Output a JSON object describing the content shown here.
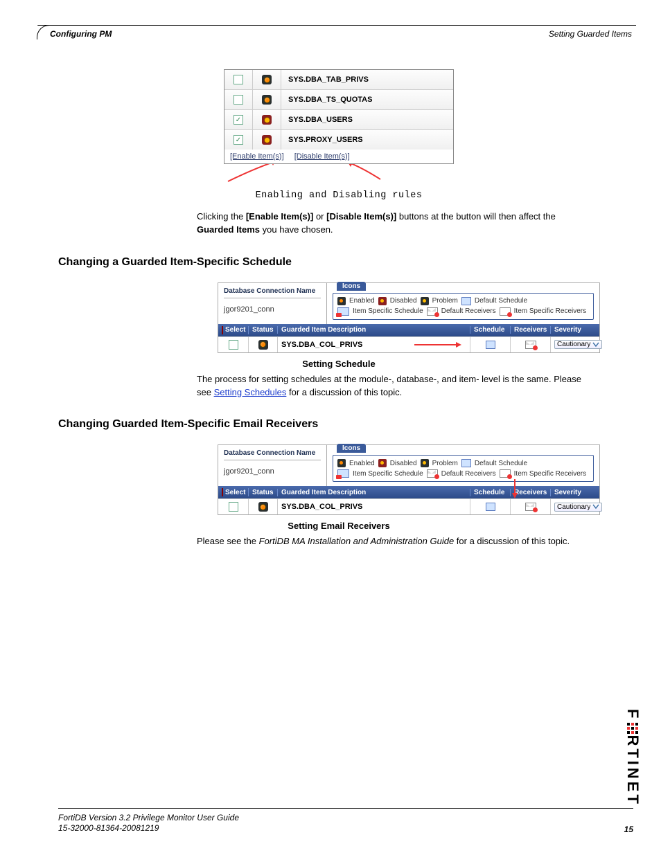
{
  "header": {
    "left": "Configuring PM",
    "right": "Setting Guarded Items"
  },
  "fig1": {
    "rows": [
      {
        "checked": false,
        "enabled": true,
        "desc": "SYS.DBA_TAB_PRIVS"
      },
      {
        "checked": false,
        "enabled": true,
        "desc": "SYS.DBA_TS_QUOTAS"
      },
      {
        "checked": true,
        "enabled": false,
        "desc": "SYS.DBA_USERS"
      },
      {
        "checked": true,
        "enabled": false,
        "desc": "SYS.PROXY_USERS"
      }
    ],
    "link_enable": "[Enable Item(s)]",
    "link_disable": "[Disable Item(s)]",
    "caption": "Enabling and Disabling rules"
  },
  "para1a": "Clicking the ",
  "para1b": "[Enable Item(s)]",
  "para1c": " or ",
  "para1d": "[Disable Item(s)]",
  "para1e": " buttons at the button will then affect the ",
  "para1f": "Guarded Items",
  "para1g": " you have chosen.",
  "section2": "Changing a Guarded Item-Specific Schedule",
  "panel": {
    "db_label": "Database Connection Name",
    "db_value": "jgor9201_conn",
    "icons_title": "Icons",
    "legend": {
      "enabled": "Enabled",
      "disabled": "Disabled",
      "problem": "Problem",
      "default_schedule": "Default Schedule",
      "item_specific_schedule": "Item Specific Schedule",
      "default_receivers": "Default Receivers",
      "item_specific_receivers": "Item Specific Receivers"
    },
    "grid_head": {
      "select": "Select",
      "status": "Status",
      "desc": "Guarded Item Description",
      "schedule": "Schedule",
      "receivers": "Receivers",
      "severity": "Severity"
    },
    "grid_row": {
      "desc": "SYS.DBA_COL_PRIVS",
      "severity": "Cautionary"
    }
  },
  "caption2": "Setting Schedule",
  "para2a": "The process for setting schedules at the module-, database-, and item- level is the same. Please see  ",
  "para2link": "Setting Schedules",
  "para2b": " for a discussion of this topic.",
  "section3": "Changing Guarded Item-Specific Email Receivers",
  "caption3": "Setting Email Receivers",
  "para3a": "Please see the ",
  "para3i": "FortiDB MA Installation and Administration Guide",
  "para3b": " for a discussion of this topic.",
  "footer": {
    "line1": "FortiDB Version 3.2 Privilege Monitor  User Guide",
    "line2": "15-32000-81364-20081219",
    "page": "15"
  },
  "logo": "F RTINET"
}
